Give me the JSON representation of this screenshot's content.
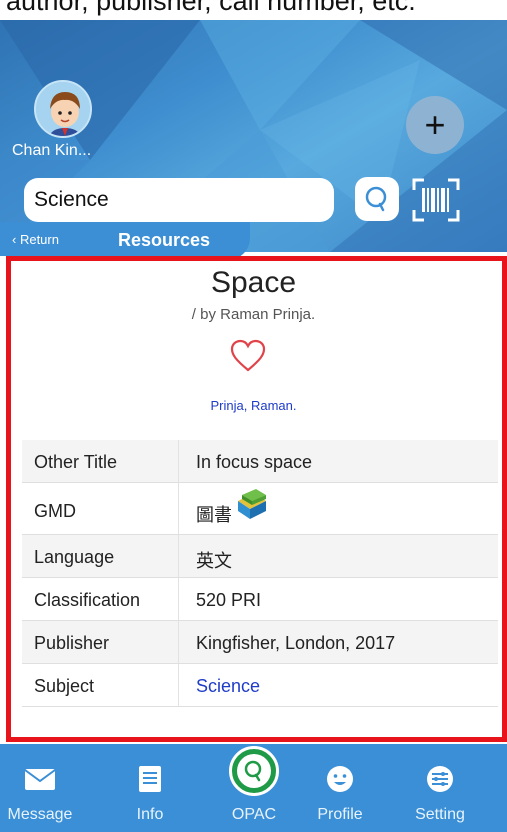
{
  "top_caption": "author, publisher, call number, etc.",
  "header": {
    "user_name": "Chan Kin...",
    "add_label": "+",
    "search_value": "Science"
  },
  "nav": {
    "return_label": "Return",
    "section_label": "Resources"
  },
  "record": {
    "title": "Space",
    "byline": "/ by Raman Prinja.",
    "author_link": "Prinja, Raman.",
    "fields": [
      {
        "label": "Other Title",
        "value": "In focus space"
      },
      {
        "label": "GMD",
        "value": "圖書"
      },
      {
        "label": "Language",
        "value": "英文"
      },
      {
        "label": "Classification",
        "value": "520 PRI"
      },
      {
        "label": "Publisher",
        "value": "Kingfisher, London, 2017"
      },
      {
        "label": "Subject",
        "value": "Science"
      }
    ]
  },
  "tabbar": {
    "items": [
      {
        "label": "Message",
        "icon": "envelope-icon"
      },
      {
        "label": "Info",
        "icon": "document-icon"
      },
      {
        "label": "OPAC",
        "icon": "search-icon"
      },
      {
        "label": "Profile",
        "icon": "face-icon"
      },
      {
        "label": "Setting",
        "icon": "sliders-icon"
      }
    ],
    "active": "OPAC"
  },
  "colors": {
    "header_blue": "#3f8ecf",
    "tabbar_blue": "#3b8fd6",
    "highlight_frame": "#e8141b",
    "link_blue": "#1f3cc8",
    "opac_green": "#1f9a47",
    "heart": "#e0444a"
  }
}
